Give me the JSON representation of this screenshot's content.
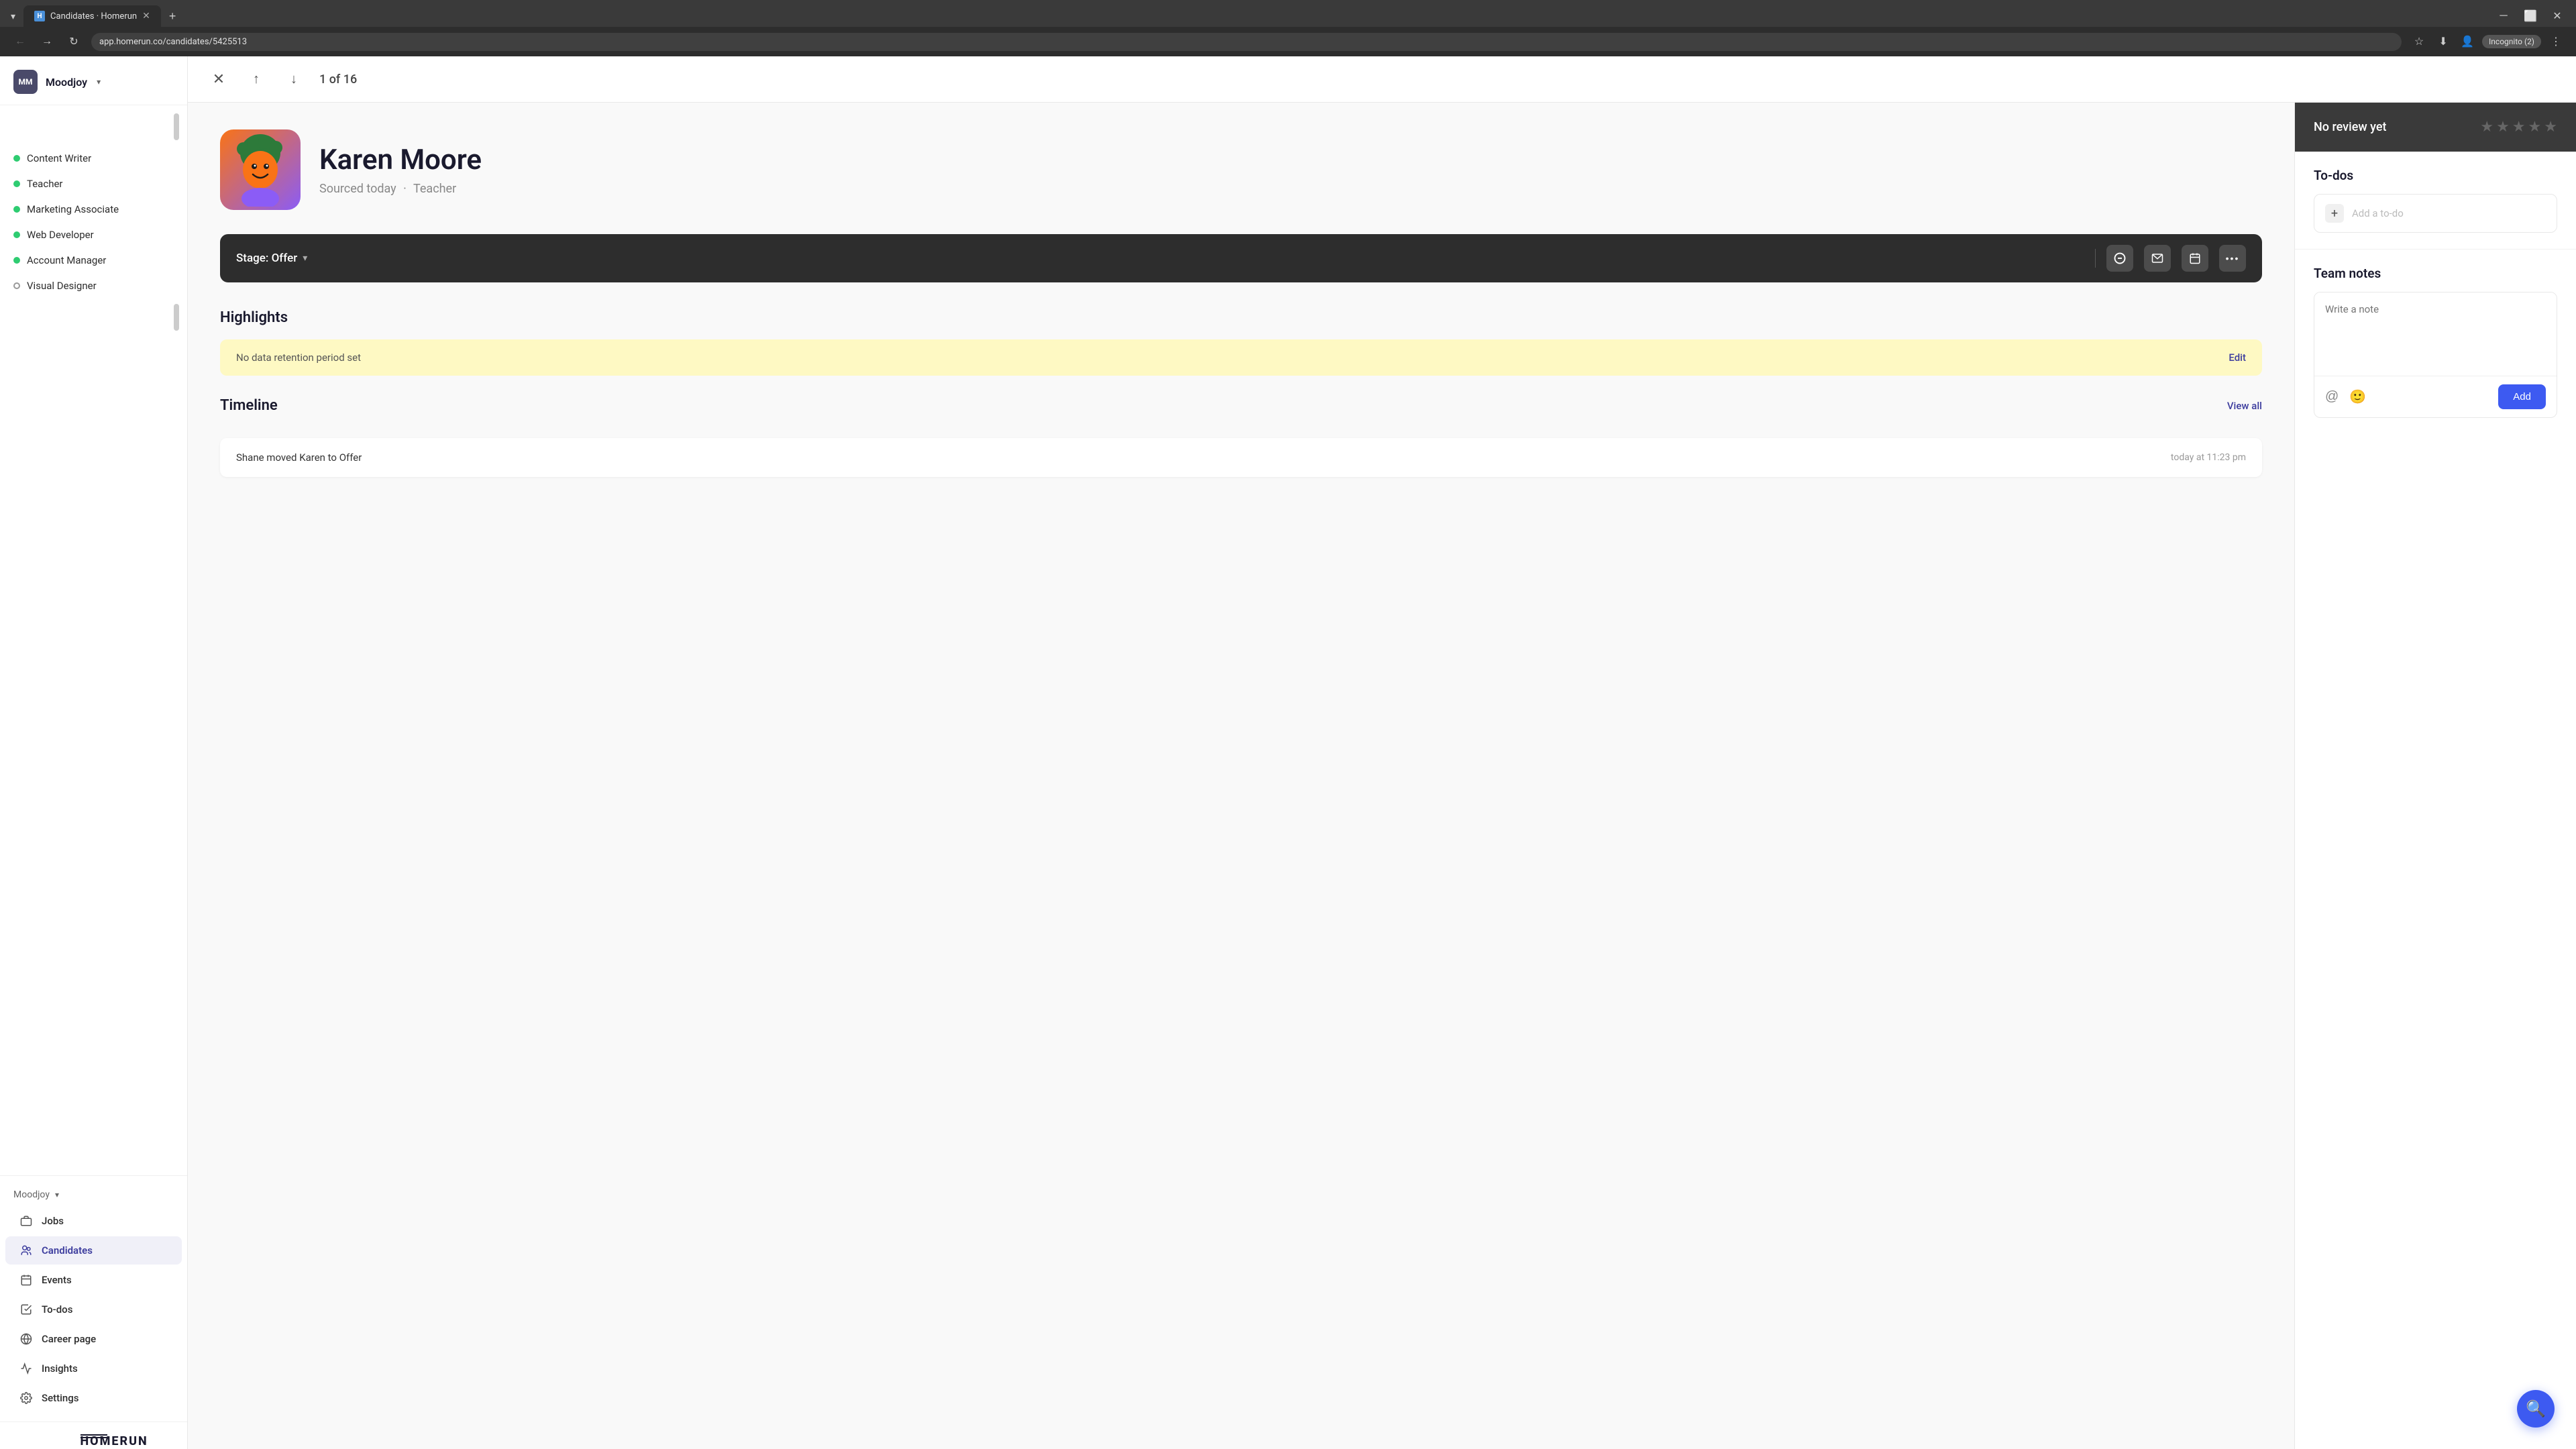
{
  "browser": {
    "tab_title": "Candidates · Homerun",
    "tab_favicon": "H",
    "url": "app.homerun.co/candidates/5425513",
    "incognito_label": "Incognito (2)"
  },
  "sidebar": {
    "org_avatar": "MM",
    "org_name": "Moodjoy",
    "job_list": [
      {
        "id": "content-writer",
        "label": "Content Writer",
        "dot": "green"
      },
      {
        "id": "teacher",
        "label": "Teacher",
        "dot": "green"
      },
      {
        "id": "marketing-associate",
        "label": "Marketing Associate",
        "dot": "green"
      },
      {
        "id": "web-developer",
        "label": "Web Developer",
        "dot": "green"
      },
      {
        "id": "account-manager",
        "label": "Account Manager",
        "dot": "green"
      },
      {
        "id": "visual-designer",
        "label": "Visual Designer",
        "dot": "outline"
      }
    ],
    "nav_org_label": "Moodjoy",
    "nav_items": [
      {
        "id": "jobs",
        "label": "Jobs",
        "icon": "briefcase"
      },
      {
        "id": "candidates",
        "label": "Candidates",
        "icon": "candidates",
        "active": true
      },
      {
        "id": "events",
        "label": "Events",
        "icon": "calendar"
      },
      {
        "id": "todos",
        "label": "To-dos",
        "icon": "checkbox"
      },
      {
        "id": "career-page",
        "label": "Career page",
        "icon": "globe"
      },
      {
        "id": "insights",
        "label": "Insights",
        "icon": "chart"
      },
      {
        "id": "settings",
        "label": "Settings",
        "icon": "gear"
      }
    ],
    "logo": "HOMERUN"
  },
  "topbar": {
    "counter": "1 of 16"
  },
  "candidate": {
    "name": "Karen Moore",
    "sourced_text": "Sourced today",
    "role": "Teacher",
    "stage_label": "Stage: Offer"
  },
  "highlights": {
    "title": "Highlights",
    "warning_text": "No data retention period set",
    "edit_label": "Edit"
  },
  "timeline": {
    "title": "Timeline",
    "view_all_label": "View all",
    "items": [
      {
        "description": "Shane moved Karen to Offer",
        "time": "today at 11:23 pm"
      }
    ]
  },
  "right_panel": {
    "review_label": "No review yet",
    "stars": [
      "★",
      "★",
      "★",
      "★",
      "★"
    ],
    "todos_title": "To-dos",
    "add_todo_placeholder": "Add a to-do",
    "notes_title": "Team notes",
    "notes_placeholder": "Write a note",
    "add_button_label": "Add"
  },
  "colors": {
    "accent_blue": "#3d5af1",
    "sidebar_active": "#f0f0f8",
    "dot_green": "#2ecc71",
    "warning_bg": "#fef9c3",
    "dark_bar": "#2d2d2d",
    "review_bar": "#3a3a3a"
  }
}
